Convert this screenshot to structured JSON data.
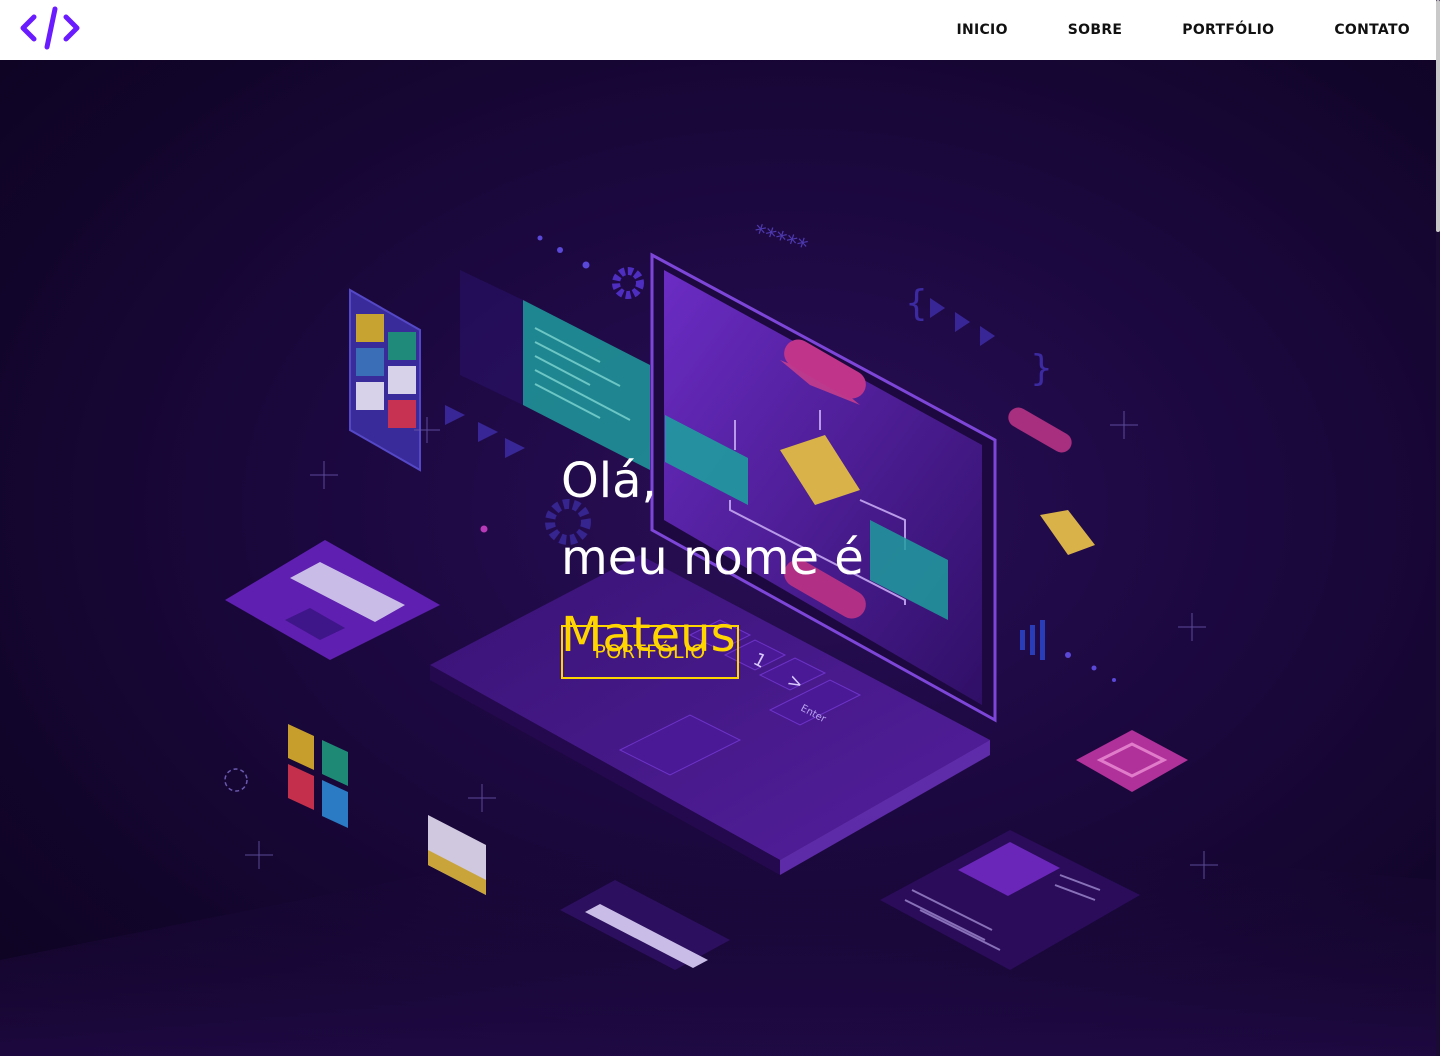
{
  "header": {
    "logo_icon": "code-brackets-icon",
    "nav": [
      {
        "label": "INICIO"
      },
      {
        "label": "SOBRE"
      },
      {
        "label": "PORTFÓLIO"
      },
      {
        "label": "CONTATO"
      }
    ]
  },
  "hero": {
    "line1": "Olá,",
    "line2": "meu nome é",
    "name": "Mateus",
    "cta_label": "PORTFÓLIO",
    "laptop_key_labels": [
      "1",
      ">",
      "Enter"
    ],
    "password_mask": "*****"
  },
  "colors": {
    "accent": "#ffd500",
    "logo": "#6a1bff",
    "background": "#1c0840",
    "nav_text": "#111111"
  }
}
